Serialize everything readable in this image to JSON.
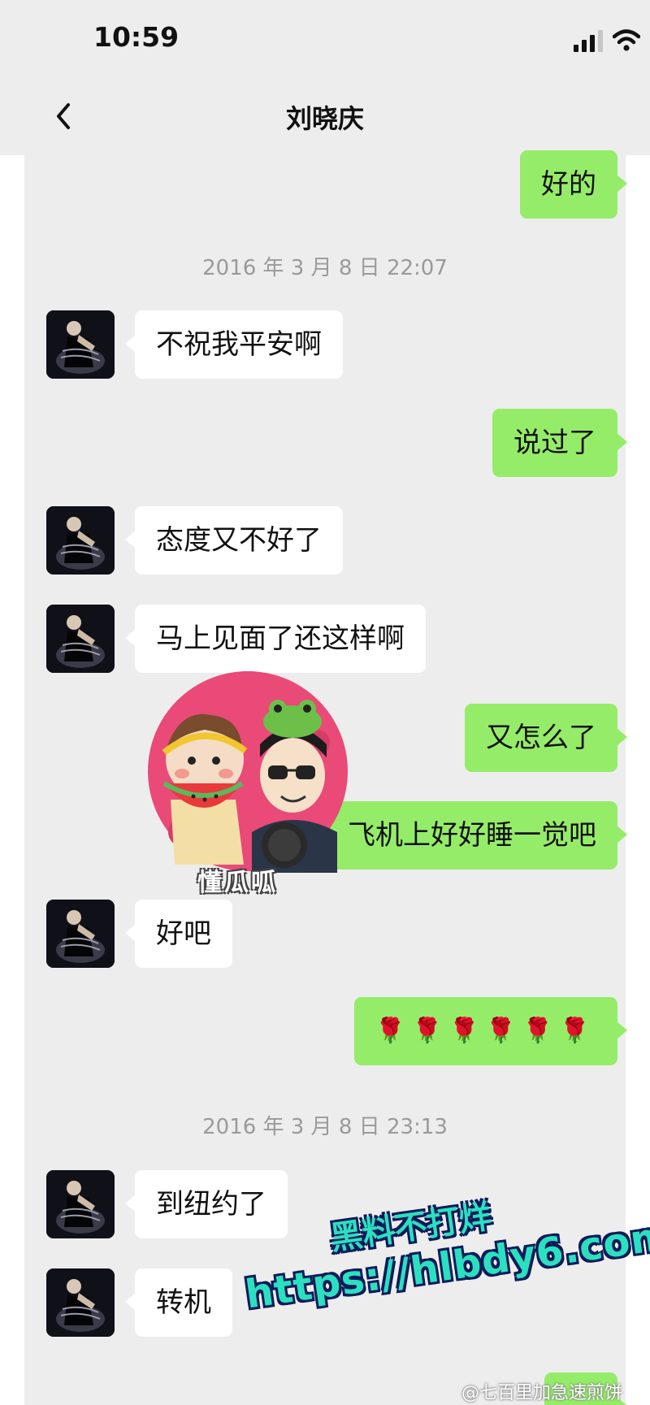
{
  "status_bar": {
    "time": "10:59"
  },
  "header": {
    "title": "刘晓庆"
  },
  "messages": [
    {
      "side": "out",
      "text": "好的"
    },
    {
      "type": "time",
      "text": "2016 年 3 月 8 日 22:07"
    },
    {
      "side": "in",
      "text": "不祝我平安啊"
    },
    {
      "side": "out",
      "text": "说过了"
    },
    {
      "side": "in",
      "text": "态度又不好了"
    },
    {
      "side": "in",
      "text": "马上见面了还这样啊"
    },
    {
      "side": "out",
      "text": "又怎么了"
    },
    {
      "side": "out",
      "text": "飞机上好好睡一觉吧"
    },
    {
      "side": "in",
      "text": "好吧"
    },
    {
      "side": "out",
      "text": "🌹🌹🌹🌹🌹🌹"
    },
    {
      "type": "time",
      "text": "2016 年 3 月 8 日 23:13"
    },
    {
      "side": "in",
      "text": "到纽约了"
    },
    {
      "side": "in",
      "text": "转机"
    }
  ],
  "overlays": {
    "sticker_caption": "懂瓜呱",
    "watermark_line1": "黑料不打烊",
    "watermark_line2": "https://hlbdy6.com",
    "weibo_credit": "@七百里加急速煎饼"
  },
  "colors": {
    "background": "#ededed",
    "outgoing_bubble": "#95ec69",
    "incoming_bubble": "#ffffff"
  }
}
